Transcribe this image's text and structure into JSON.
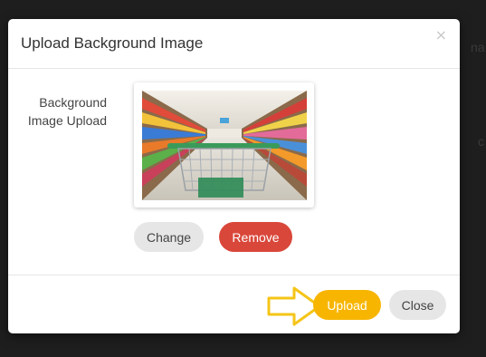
{
  "modal": {
    "title": "Upload Background Image",
    "close_glyph": "×",
    "field_label_line1": "Background",
    "field_label_line2": "Image Upload",
    "image_description_icon": "supermarket-aisle-photo",
    "change_label": "Change",
    "remove_label": "Remove",
    "upload_label": "Upload",
    "close_label": "Close"
  },
  "backdrop": {
    "fragment_top": "na",
    "fragment_mid": "c"
  },
  "colors": {
    "upload": "#f7b500",
    "remove": "#d9473a",
    "neutral_button": "#e6e6e6",
    "arrow": "#f5c518"
  }
}
